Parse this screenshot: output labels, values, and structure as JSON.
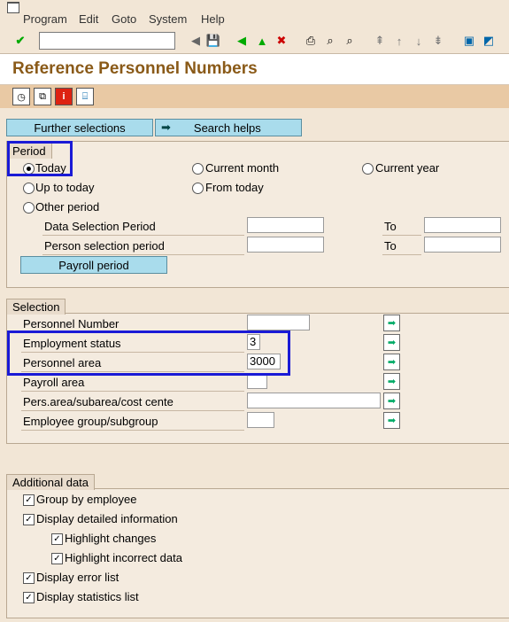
{
  "menu": [
    "Program",
    "Edit",
    "Goto",
    "System",
    "Help"
  ],
  "title": "Reference Personnel Numbers",
  "buttons": {
    "further": "Further selections",
    "search": "Search helps",
    "payroll": "Payroll period"
  },
  "period": {
    "label": "Period",
    "today": "Today",
    "current_month": "Current month",
    "current_year": "Current year",
    "up_to_today": "Up to today",
    "from_today": "From today",
    "other_period": "Other period",
    "data_sel": "Data Selection Period",
    "person_sel": "Person selection period",
    "to": "To"
  },
  "selection": {
    "label": "Selection",
    "fields": [
      {
        "label": "Personnel Number",
        "value": ""
      },
      {
        "label": "Employment status",
        "value": "3"
      },
      {
        "label": "Personnel area",
        "value": "3000"
      },
      {
        "label": "Payroll area",
        "value": ""
      },
      {
        "label": "Pers.area/subarea/cost cente",
        "value": ""
      },
      {
        "label": "Employee group/subgroup",
        "value": ""
      }
    ]
  },
  "additional": {
    "label": "Additional data",
    "items": [
      {
        "label": "Group by employee",
        "checked": true
      },
      {
        "label": "Display detailed information",
        "checked": true
      },
      {
        "label": "Highlight changes",
        "checked": true
      },
      {
        "label": "Highlight incorrect data",
        "checked": true
      },
      {
        "label": "Display error list",
        "checked": true
      },
      {
        "label": "Display statistics list",
        "checked": true
      }
    ]
  },
  "colors": {
    "highlight": "#1a1ad6",
    "title": "#8a5a18",
    "button": "#a9dcec"
  },
  "icons": [
    "enter-icon",
    "save-icon",
    "back-icon",
    "exit-icon",
    "cancel-icon",
    "print-icon",
    "find-icon",
    "find-next-icon",
    "first-page-icon",
    "previous-page-icon",
    "next-page-icon",
    "last-page-icon",
    "create-session-icon",
    "shortcut-icon",
    "execute-icon",
    "variant-icon",
    "info-icon",
    "selection-options-icon"
  ]
}
